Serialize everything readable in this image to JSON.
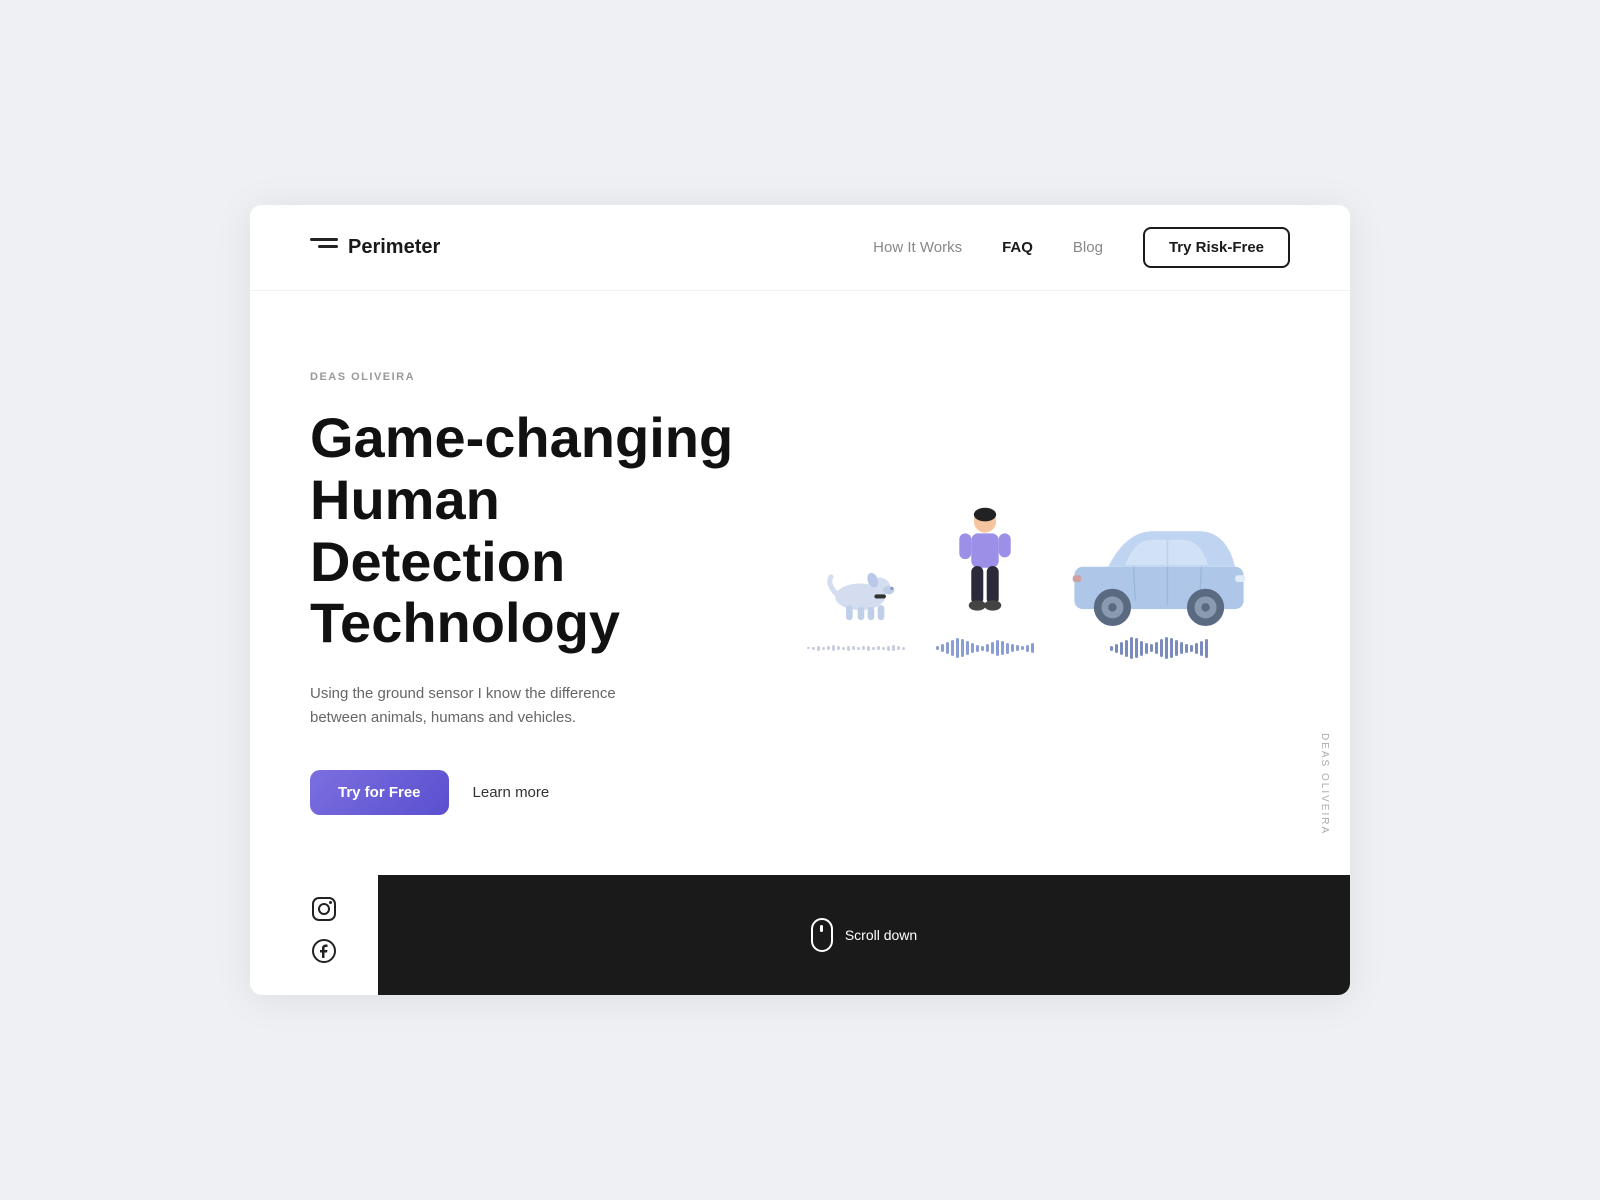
{
  "brand": {
    "name": "Perimeter"
  },
  "nav": {
    "links": [
      {
        "id": "how-it-works",
        "label": "How It Works",
        "active": false
      },
      {
        "id": "faq",
        "label": "FAQ",
        "active": true
      },
      {
        "id": "blog",
        "label": "Blog",
        "active": false
      }
    ],
    "cta": "Try Risk-Free"
  },
  "hero": {
    "author": "DEAS OLIVEIRA",
    "title_line1": "Game-changing",
    "title_line2": "Human Detection",
    "title_line3": "Technology",
    "description": "Using the ground sensor I know the difference between animals, humans and vehicles.",
    "btn_primary": "Try for Free",
    "btn_secondary": "Learn more"
  },
  "scroll": {
    "label": "Scroll down"
  },
  "side_label": "DEAS OLIVEIRA",
  "waveform": {
    "dog": [
      2,
      3,
      5,
      3,
      4,
      6,
      4,
      3,
      5,
      4,
      3,
      4,
      5,
      3,
      4,
      3,
      5,
      6,
      4,
      3
    ],
    "person": [
      4,
      8,
      12,
      16,
      20,
      18,
      14,
      10,
      7,
      5,
      8,
      12,
      16,
      14,
      11,
      8,
      6,
      4,
      7,
      10
    ],
    "car": [
      5,
      9,
      13,
      17,
      22,
      20,
      15,
      11,
      8,
      12,
      18,
      22,
      20,
      16,
      12,
      9,
      7,
      11,
      15,
      19
    ]
  },
  "colors": {
    "accent": "#6c5ce7",
    "dark": "#1a1a1a",
    "muted": "#999",
    "waveform_dog": "#c8cde0",
    "waveform_person": "#8b9ed4",
    "waveform_car": "#7a8cbf"
  }
}
